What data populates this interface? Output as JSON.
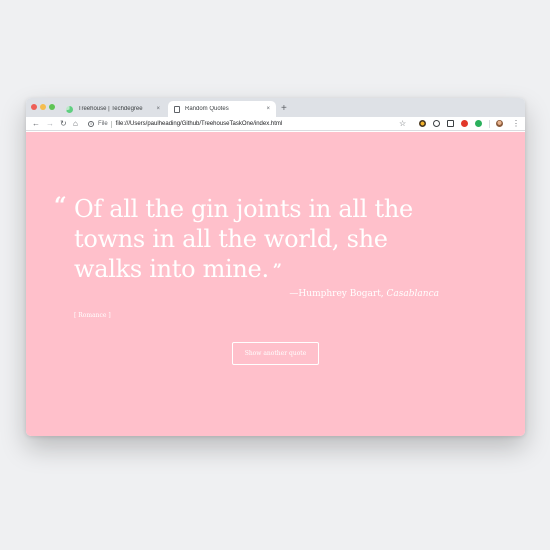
{
  "browser": {
    "tabs": [
      {
        "title": "Treehouse | Techdegree",
        "close": "×",
        "favicon": "treehouse-icon"
      },
      {
        "title": "Random Quotes",
        "close": "×",
        "favicon": "document-icon",
        "active": true
      }
    ],
    "new_tab": "+",
    "nav": {
      "back": "←",
      "forward": "→",
      "reload": "↻",
      "home": "⌂"
    },
    "address_bar": {
      "info_glyph": "i",
      "scheme_label": "File",
      "url": "file:///Users/paulheading/Github/TreehouseTaskOne/index.html"
    },
    "bookmark_star": "☆",
    "menu": "⋮"
  },
  "page": {
    "background_color": "#ffc0cb",
    "quote_open_mark": "“",
    "quote": "Of all the gin joints in all the towns in all the world, she walks into mine.",
    "quote_close_mark": "”",
    "source": "—Humphrey Bogart, ",
    "citation": "Casablanca",
    "tags": "[ Romance ]",
    "button_label": "Show another quote"
  }
}
